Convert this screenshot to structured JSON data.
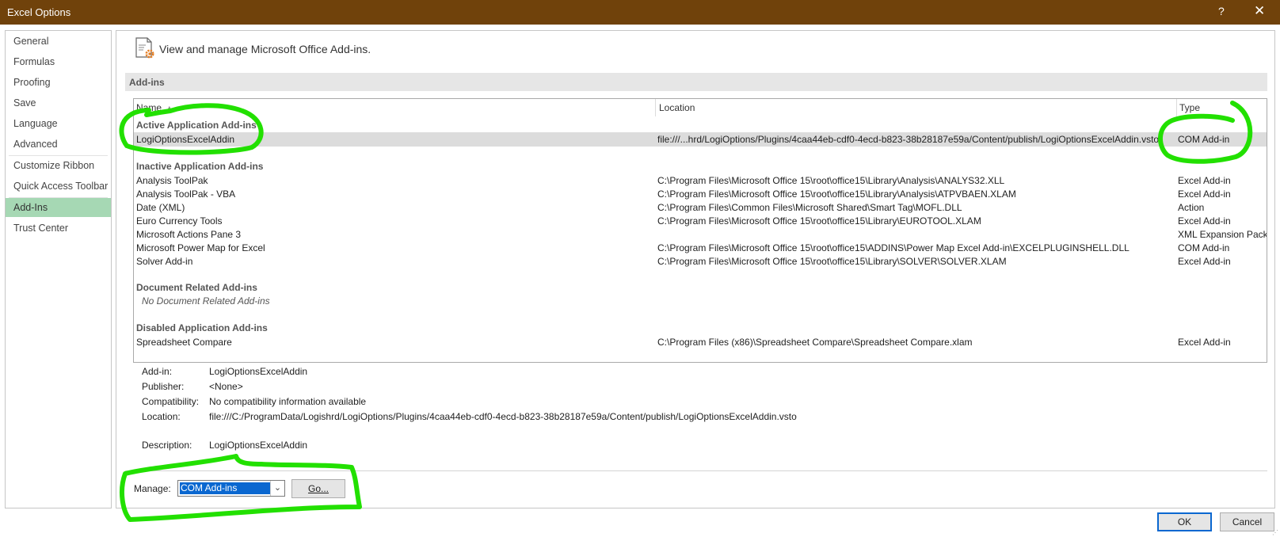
{
  "window": {
    "title": "Excel Options",
    "help_label": "?",
    "close_label": "✕"
  },
  "sidebar": {
    "items": [
      {
        "label": "General"
      },
      {
        "label": "Formulas"
      },
      {
        "label": "Proofing"
      },
      {
        "label": "Save"
      },
      {
        "label": "Language"
      },
      {
        "label": "Advanced"
      },
      {
        "label": "Customize Ribbon"
      },
      {
        "label": "Quick Access Toolbar"
      },
      {
        "label": "Add-Ins",
        "active": true
      },
      {
        "label": "Trust Center"
      }
    ]
  },
  "header": {
    "icon": "addin-gear-icon",
    "text": "View and manage Microsoft Office Add-ins."
  },
  "section": {
    "title": "Add-ins"
  },
  "table": {
    "columns": {
      "name": "Name",
      "name_sort": "▲",
      "location": "Location",
      "type": "Type"
    },
    "groups": [
      {
        "title": "Active Application Add-ins",
        "rows": [
          {
            "name": "LogiOptionsExcelAddin",
            "location": "file:///...hrd/LogiOptions/Plugins/4caa44eb-cdf0-4ecd-b823-38b28187e59a/Content/publish/LogiOptionsExcelAddin.vsto",
            "type": "COM Add-in",
            "selected": true
          }
        ]
      },
      {
        "title": "Inactive Application Add-ins",
        "rows": [
          {
            "name": "Analysis ToolPak",
            "location": "C:\\Program Files\\Microsoft Office 15\\root\\office15\\Library\\Analysis\\ANALYS32.XLL",
            "type": "Excel Add-in"
          },
          {
            "name": "Analysis ToolPak - VBA",
            "location": "C:\\Program Files\\Microsoft Office 15\\root\\office15\\Library\\Analysis\\ATPVBAEN.XLAM",
            "type": "Excel Add-in"
          },
          {
            "name": "Date (XML)",
            "location": "C:\\Program Files\\Common Files\\Microsoft Shared\\Smart Tag\\MOFL.DLL",
            "type": "Action"
          },
          {
            "name": "Euro Currency Tools",
            "location": "C:\\Program Files\\Microsoft Office 15\\root\\office15\\Library\\EUROTOOL.XLAM",
            "type": "Excel Add-in"
          },
          {
            "name": "Microsoft Actions Pane 3",
            "location": "",
            "type": "XML Expansion Pack"
          },
          {
            "name": "Microsoft Power Map for Excel",
            "location": "C:\\Program Files\\Microsoft Office 15\\root\\office15\\ADDINS\\Power Map Excel Add-in\\EXCELPLUGINSHELL.DLL",
            "type": "COM Add-in"
          },
          {
            "name": "Solver Add-in",
            "location": "C:\\Program Files\\Microsoft Office 15\\root\\office15\\Library\\SOLVER\\SOLVER.XLAM",
            "type": "Excel Add-in"
          }
        ]
      },
      {
        "title": "Document Related Add-ins",
        "empty_note": "No Document Related Add-ins",
        "rows": []
      },
      {
        "title": "Disabled Application Add-ins",
        "rows": [
          {
            "name": "Spreadsheet Compare",
            "location": "C:\\Program Files (x86)\\Spreadsheet Compare\\Spreadsheet Compare.xlam",
            "type": "Excel Add-in"
          }
        ]
      }
    ]
  },
  "details": {
    "addin": {
      "label": "Add-in:",
      "value": "LogiOptionsExcelAddin"
    },
    "publisher": {
      "label": "Publisher:",
      "value": "<None>"
    },
    "compatibility": {
      "label": "Compatibility:",
      "value": "No compatibility information available"
    },
    "location": {
      "label": "Location:",
      "value": "file:///C:/ProgramData/Logishrd/LogiOptions/Plugins/4caa44eb-cdf0-4ecd-b823-38b28187e59a/Content/publish/LogiOptionsExcelAddin.vsto"
    },
    "description": {
      "label": "Description:",
      "value": "LogiOptionsExcelAddin"
    }
  },
  "manage": {
    "label": "Manage:",
    "selected": "COM Add-ins",
    "go_label": "Go..."
  },
  "footer": {
    "ok_label": "OK",
    "cancel_label": "Cancel"
  },
  "colors": {
    "titlebar": "#70420b",
    "active_nav": "#a6d8b4",
    "highlight_marker": "#22e000",
    "select_blue": "#0a67d0"
  }
}
